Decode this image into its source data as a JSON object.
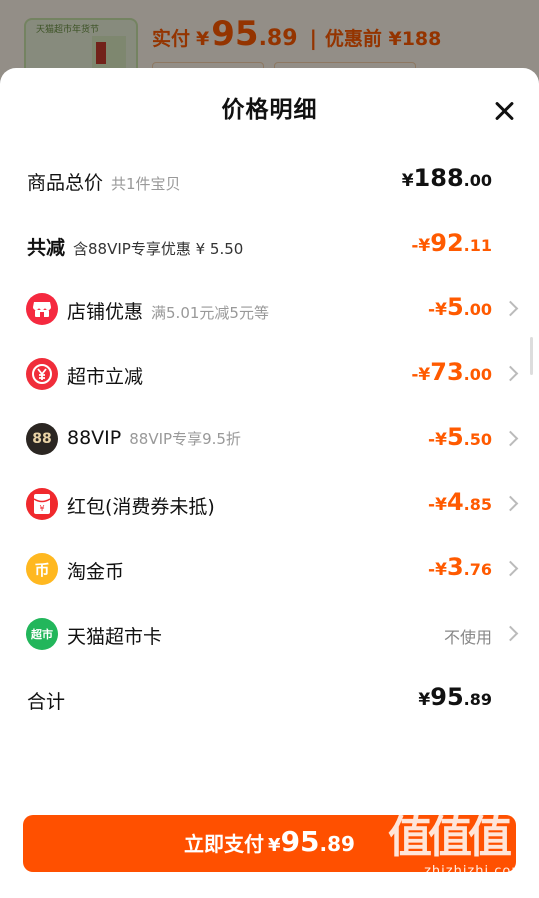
{
  "background": {
    "thumb_label": "天猫超市年货节",
    "pay_prefix": "实付",
    "pay_yen": "¥",
    "pay_int": "95",
    "pay_dec": ".89",
    "before_label": "优惠前 ¥188"
  },
  "sheet": {
    "title": "价格明细"
  },
  "rows": {
    "total": {
      "label": "商品总价",
      "sub": "共1件宝贝",
      "yen": "¥",
      "int": "188",
      "dec": ".00"
    },
    "reduced": {
      "label": "共减",
      "sub": "含88VIP专享优惠 ¥ 5.50",
      "sign": "-",
      "yen": "¥",
      "int": "92",
      "dec": ".11"
    },
    "shop": {
      "label": "店铺优惠",
      "sub": "满5.01元减5元等",
      "sign": "-",
      "yen": "¥",
      "int": "5",
      "dec": ".00",
      "icon": "shop-icon"
    },
    "market": {
      "label": "超市立减",
      "sign": "-",
      "yen": "¥",
      "int": "73",
      "dec": ".00",
      "icon": "yuan-coin-icon",
      "icon_text": "¥"
    },
    "vip": {
      "label": "88VIP",
      "sub": "88VIP专享9.5折",
      "sign": "-",
      "yen": "¥",
      "int": "5",
      "dec": ".50",
      "icon": "88vip-icon",
      "icon_text": "88"
    },
    "redpacket": {
      "label": "红包(消费券未抵)",
      "sign": "-",
      "yen": "¥",
      "int": "4",
      "dec": ".85",
      "icon": "red-packet-icon",
      "icon_text": "¥"
    },
    "coin": {
      "label": "淘金币",
      "sign": "-",
      "yen": "¥",
      "int": "3",
      "dec": ".76",
      "icon": "gold-coin-icon",
      "icon_text": "币"
    },
    "card": {
      "label": "天猫超市卡",
      "status": "不使用",
      "icon": "tmall-market-card-icon",
      "icon_text": "超市"
    },
    "sum": {
      "label": "合计",
      "yen": "¥",
      "int": "95",
      "dec": ".89"
    }
  },
  "pay_button": {
    "label": "立即支付",
    "yen": "¥",
    "int": "95",
    "dec": ".89"
  },
  "watermark": {
    "chars": "值值值",
    "url": "zhizhizhi.com"
  },
  "colors": {
    "accent": "#ff5000",
    "discount": "#ff5a00",
    "shop_icon": "#f5293f",
    "market_icon": "#f02d3a",
    "vip_icon": "#2b2622",
    "redpacket_icon": "#f0292d",
    "coin_icon": "#ffb820",
    "card_icon": "#22b65b"
  }
}
